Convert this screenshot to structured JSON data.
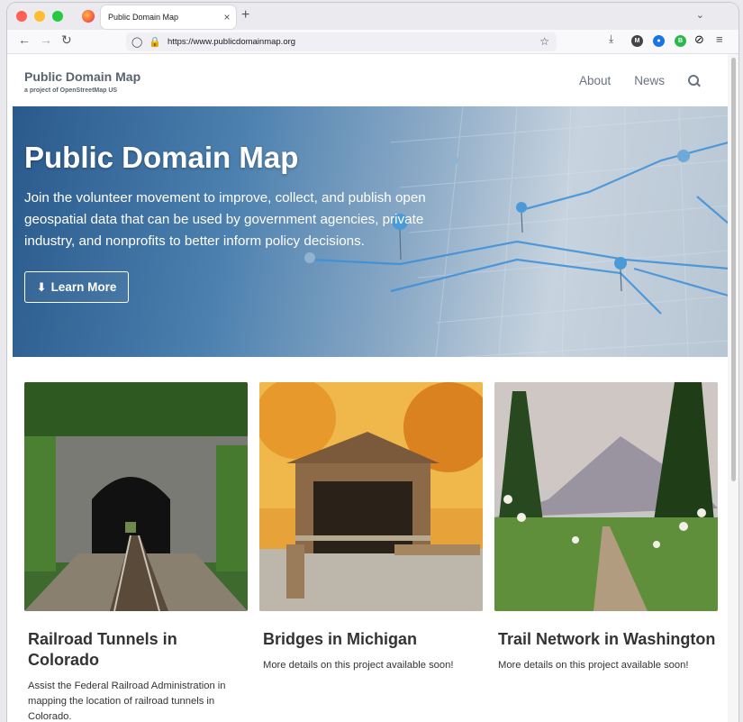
{
  "browser": {
    "tab_title": "Public Domain Map",
    "tab_close": "×",
    "new_tab": "+",
    "url": "https://www.publicdomainmap.org"
  },
  "site": {
    "brand_title": "Public Domain Map",
    "brand_subtitle": "a project of OpenStreetMap US",
    "nav": [
      {
        "label": "About"
      },
      {
        "label": "News"
      }
    ]
  },
  "hero": {
    "title": "Public Domain Map",
    "description": "Join the volunteer movement to improve, collect, and publish open geospatial data that can be used by government agencies, private industry, and nonprofits to better inform policy decisions.",
    "button_label": "Learn More"
  },
  "cards": [
    {
      "title": "Railroad Tunnels in Colorado",
      "text": "Assist the Federal Railroad Administration in mapping the location of railroad tunnels in Colorado."
    },
    {
      "title": "Bridges in Michigan",
      "text": "More details on this project available soon!"
    },
    {
      "title": "Trail Network in Washington",
      "text": "More details on this project available soon!"
    }
  ],
  "colors": {
    "hero_blue": "#2a5a8c",
    "text_dark": "#333333",
    "brand_gray": "#5a6270"
  }
}
